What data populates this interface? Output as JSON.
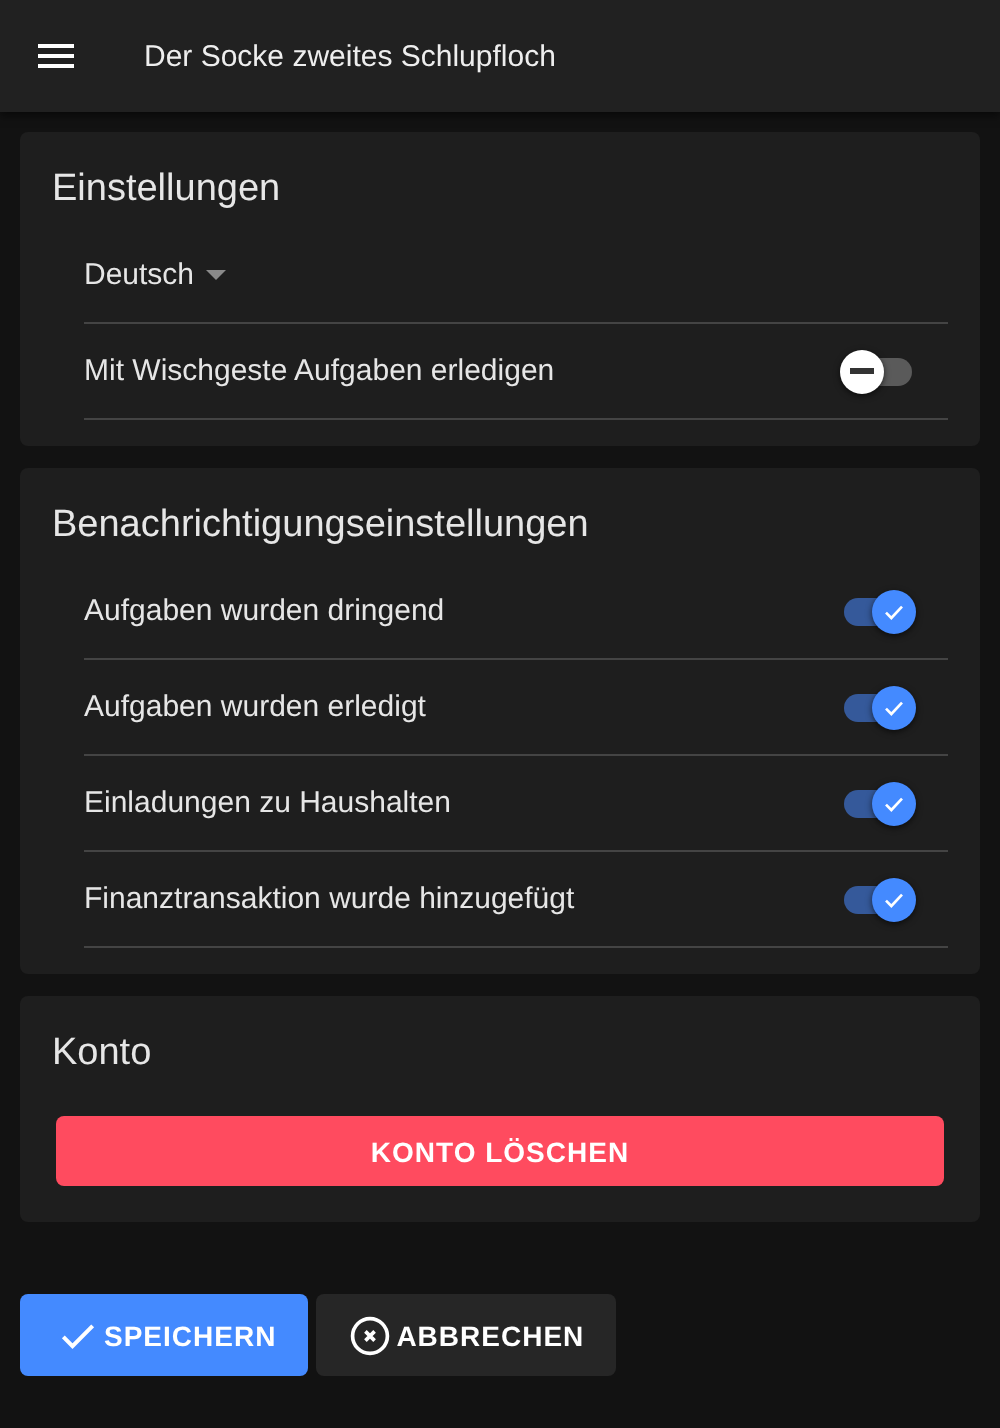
{
  "app_bar": {
    "title": "Der Socke zweites Schlupfloch"
  },
  "settings": {
    "title": "Einstellungen",
    "language": {
      "value": "Deutsch"
    },
    "toggles": [
      {
        "label": "Mit Wischgeste Aufgaben erledigen",
        "on": false
      }
    ]
  },
  "notifications": {
    "title": "Benachrichtigungseinstellungen",
    "toggles": [
      {
        "label": "Aufgaben wurden dringend",
        "on": true
      },
      {
        "label": "Aufgaben wurden erledigt",
        "on": true
      },
      {
        "label": "Einladungen zu Haushalten",
        "on": true
      },
      {
        "label": "Finanztransaktion wurde hinzugefügt",
        "on": true
      }
    ]
  },
  "account": {
    "title": "Konto",
    "delete_button": "KONTO LÖSCHEN"
  },
  "buttons": [
    {
      "kind": "save",
      "label": "SPEICHERN"
    },
    {
      "kind": "cancel",
      "label": "ABBRECHEN"
    }
  ]
}
